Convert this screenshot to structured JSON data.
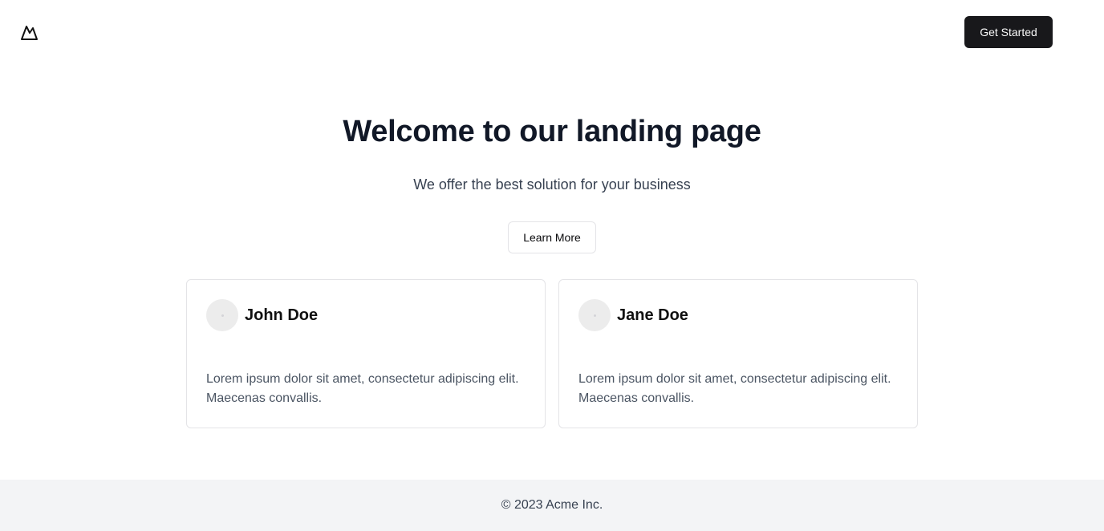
{
  "header": {
    "logo_icon": "mountain-icon",
    "cta_label": "Get Started"
  },
  "hero": {
    "title": "Welcome to our landing page",
    "subtitle": "We offer the best solution for your business",
    "button_label": "Learn More"
  },
  "cards": [
    {
      "name": "John Doe",
      "avatar_icon": "avatar-placeholder",
      "text": "Lorem ipsum dolor sit amet, consectetur adipiscing elit. Maecenas convallis."
    },
    {
      "name": "Jane Doe",
      "avatar_icon": "avatar-placeholder",
      "text": "Lorem ipsum dolor sit amet, consectetur adipiscing elit. Maecenas convallis."
    }
  ],
  "footer": {
    "text": "© 2023 Acme Inc."
  },
  "colors": {
    "primary_button": "#18181b",
    "title": "#111827",
    "muted_text": "#4b5563",
    "footer_bg": "#f3f4f6"
  }
}
